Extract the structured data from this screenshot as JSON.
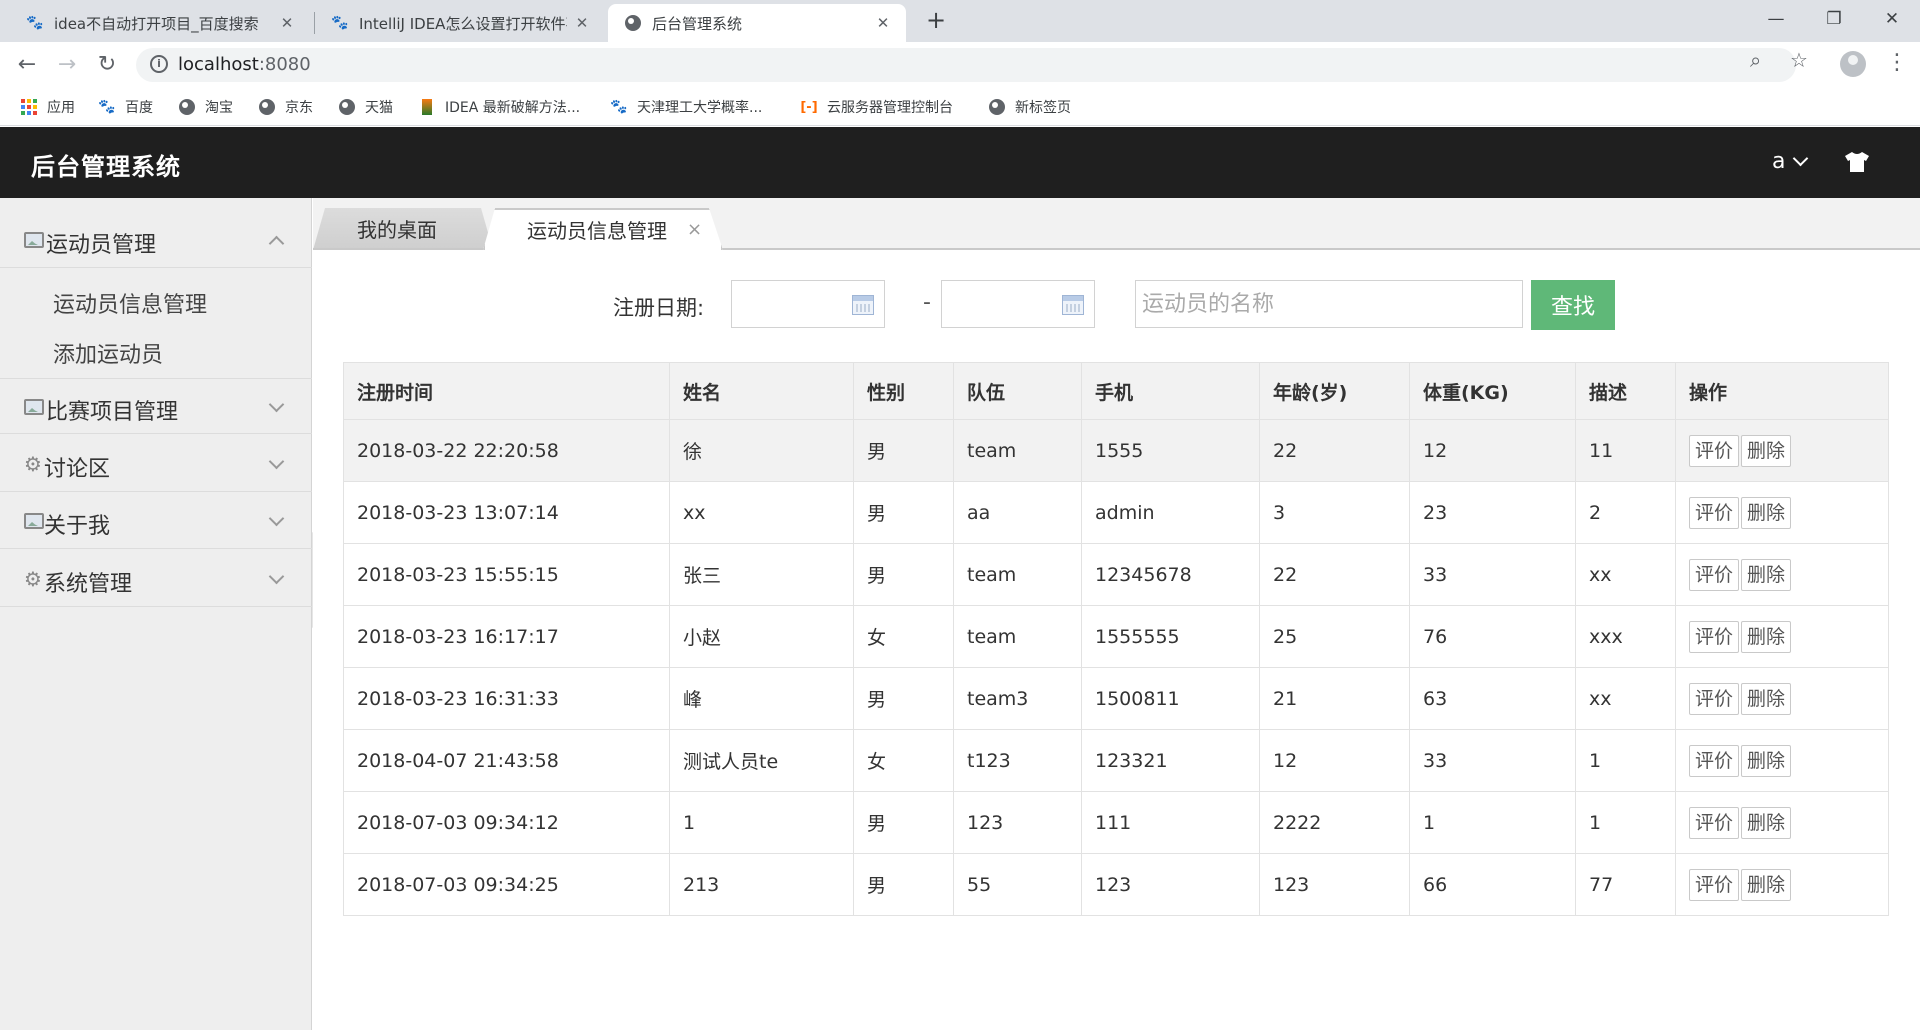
{
  "browser": {
    "tabs": [
      {
        "title": "idea不自动打开项目_百度搜索",
        "active": false,
        "icon": "baidu-paw-icon"
      },
      {
        "title": "IntelliJ IDEA怎么设置打开软件不",
        "active": false,
        "icon": "baidu-paw-icon"
      },
      {
        "title": "后台管理系统",
        "active": true,
        "icon": "globe-icon"
      }
    ],
    "new_tab": "+",
    "address": {
      "host": "localhost",
      "port": ":8080"
    },
    "bookmarks": [
      {
        "label": "应用",
        "icon": "apps-grid-icon"
      },
      {
        "label": "百度",
        "icon": "baidu-paw-icon"
      },
      {
        "label": "淘宝",
        "icon": "globe-icon"
      },
      {
        "label": "京东",
        "icon": "globe-icon"
      },
      {
        "label": "天猫",
        "icon": "globe-icon"
      },
      {
        "label": "IDEA 最新破解方法...",
        "icon": "idea-icon"
      },
      {
        "label": "天津理工大学概率...",
        "icon": "baidu-paw-icon"
      },
      {
        "label": "云服务器管理控制台",
        "icon": "aliyun-icon"
      },
      {
        "label": "新标签页",
        "icon": "globe-icon"
      }
    ]
  },
  "app": {
    "title": "后台管理系统",
    "user": "a",
    "header_bg": "#1f1f1f"
  },
  "sidebar": {
    "groups": [
      {
        "label": "运动员管理",
        "icon": "image-icon",
        "expanded": true
      },
      {
        "label": "比赛项目管理",
        "icon": "image-icon",
        "expanded": false
      },
      {
        "label": "讨论区",
        "icon": "gear-icon",
        "expanded": false
      },
      {
        "label": "关于我",
        "icon": "image-icon",
        "expanded": false
      },
      {
        "label": "系统管理",
        "icon": "gear-icon",
        "expanded": false
      }
    ],
    "sub_items": [
      "运动员信息管理",
      "添加运动员"
    ]
  },
  "content_tabs": [
    {
      "label": "我的桌面",
      "active": false
    },
    {
      "label": "运动员信息管理",
      "active": true,
      "close": "×"
    }
  ],
  "search": {
    "label": "注册日期:",
    "date_separator": "-",
    "start_date": "",
    "end_date": "",
    "name_placeholder": "运动员的名称",
    "button": "查找",
    "button_color": "#5fb878"
  },
  "table": {
    "columns": [
      "注册时间",
      "姓名",
      "性别",
      "队伍",
      "手机",
      "年龄(岁)",
      "体重(KG)",
      "描述",
      "操作"
    ],
    "rows": [
      [
        "2018-03-22 22:20:58",
        "徐",
        "男",
        "team",
        "1555",
        "22",
        "12",
        "11"
      ],
      [
        "2018-03-23 13:07:14",
        "xx",
        "男",
        "aa",
        "admin",
        "3",
        "23",
        "2"
      ],
      [
        "2018-03-23 15:55:15",
        "张三",
        "男",
        "team",
        "12345678",
        "22",
        "33",
        "xx"
      ],
      [
        "2018-03-23 16:17:17",
        "小赵",
        "女",
        "team",
        "1555555",
        "25",
        "76",
        "xxx"
      ],
      [
        "2018-03-23 16:31:33",
        "峰",
        "男",
        "team3",
        "1500811",
        "21",
        "63",
        "xx"
      ],
      [
        "2018-04-07 21:43:58",
        "测试人员te",
        "女",
        "t123",
        "123321",
        "12",
        "33",
        "1"
      ],
      [
        "2018-07-03 09:34:12",
        "1",
        "男",
        "123",
        "111",
        "2222",
        "1",
        "1"
      ],
      [
        "2018-07-03 09:34:25",
        "213",
        "男",
        "55",
        "123",
        "123",
        "66",
        "77"
      ]
    ],
    "actions": [
      "评价",
      "删除"
    ]
  }
}
